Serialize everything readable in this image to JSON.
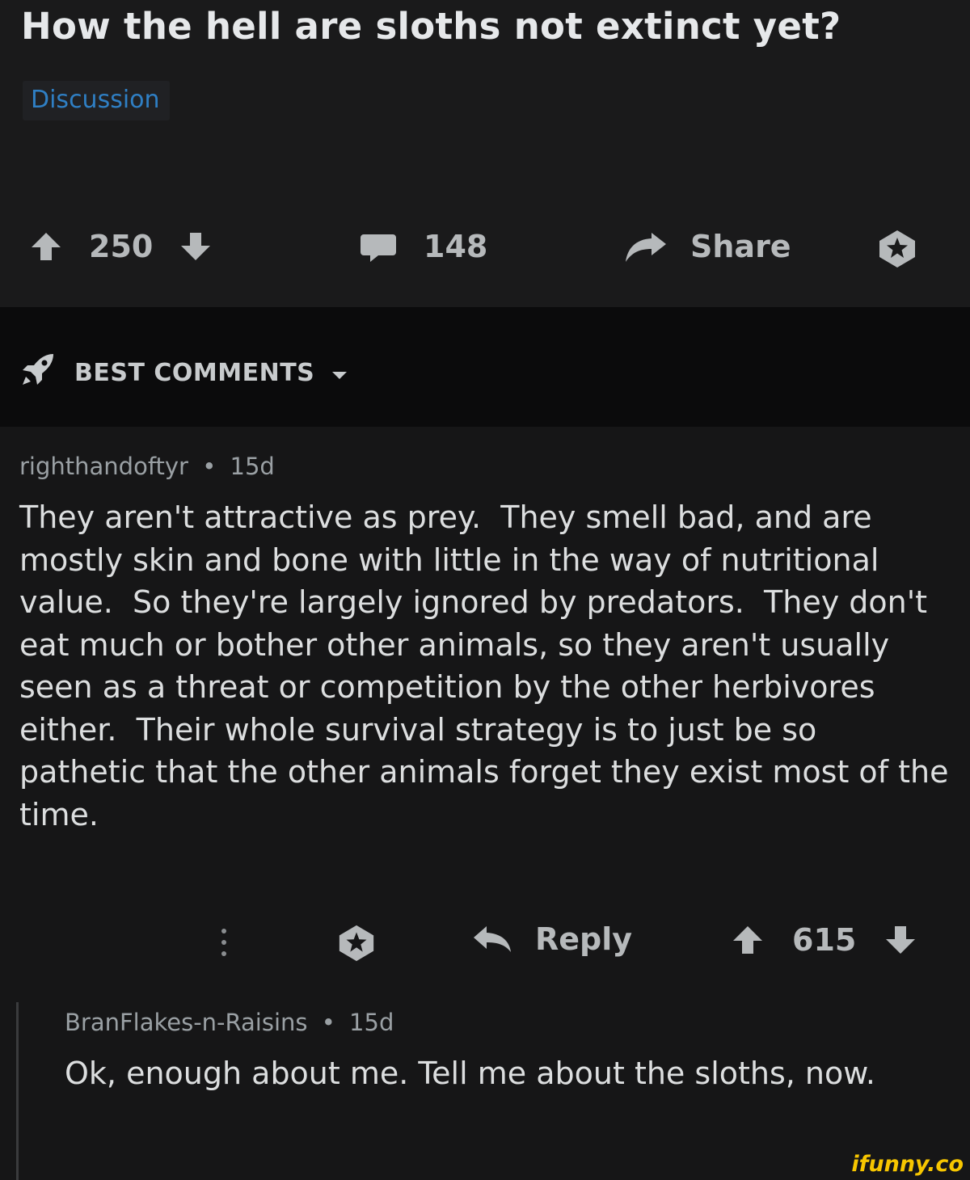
{
  "post": {
    "title": "How the hell are sloths not extinct yet?",
    "flair": "Discussion",
    "score": "250",
    "comment_count": "148",
    "share_label": "Share"
  },
  "sort": {
    "label": "BEST COMMENTS"
  },
  "comments": [
    {
      "author": "righthandoftyr",
      "age": "15d",
      "body": "They aren't attractive as prey.  They smell bad, and are mostly skin and bone with little in the way of nutritional value.  So they're largely ignored by predators.  They don't eat much or bother other animals, so they aren't usually seen as a threat or competition by the other herbivores either.  Their whole survival strategy is to just be so pathetic that the other animals forget they exist most of the time.",
      "reply_label": "Reply",
      "score": "615"
    },
    {
      "author": "BranFlakes-n-Raisins",
      "age": "15d",
      "body": "Ok, enough about me. Tell me about the sloths, now."
    }
  ],
  "separator": "•",
  "watermark": "ifunny.co",
  "colors": {
    "background": "#161617",
    "flair_text": "#2f7fc4",
    "watermark": "#f7c600"
  }
}
